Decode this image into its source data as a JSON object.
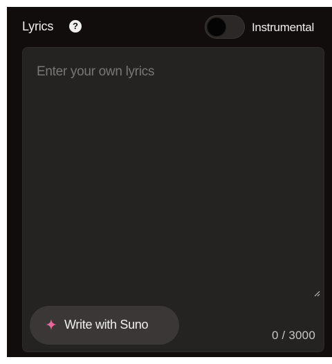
{
  "header": {
    "title": "Lyrics",
    "help_icon": "question-circle-icon",
    "instrumental_label": "Instrumental",
    "instrumental_enabled": false
  },
  "lyrics": {
    "placeholder": "Enter your own lyrics",
    "value": ""
  },
  "actions": {
    "write_label": "Write with Suno",
    "write_icon": "sparkle-icon",
    "sparkle_color": "#e8679b"
  },
  "counter": {
    "text": "0 / 3000"
  }
}
